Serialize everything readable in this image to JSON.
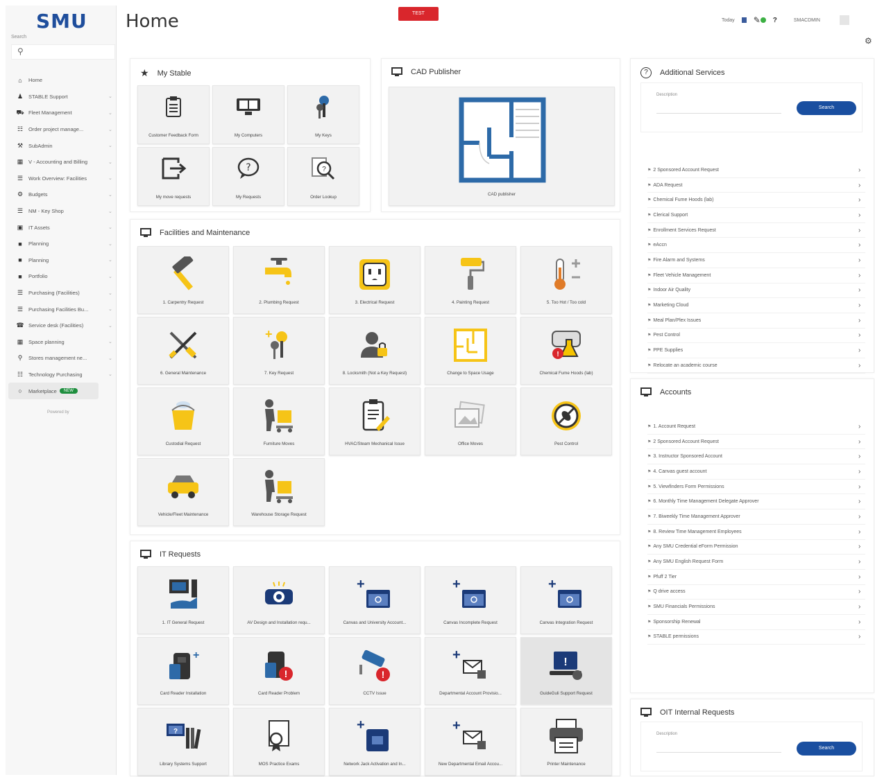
{
  "app": {
    "logo": "SMU",
    "page_title": "Home",
    "test_badge": "TEST"
  },
  "header": {
    "today_label": "Today",
    "help": "?",
    "user": "SMACDMIN"
  },
  "sidebar": {
    "search_label": "Search",
    "items": [
      {
        "label": "Home",
        "icon": "home-icon"
      },
      {
        "label": "STABLE Support",
        "icon": "person-icon"
      },
      {
        "label": "Fleet Management",
        "icon": "car-icon"
      },
      {
        "label": "Order project manage...",
        "icon": "cart-icon"
      },
      {
        "label": "SubAdmin",
        "icon": "wrench-icon"
      },
      {
        "label": "V - Accounting and Billing",
        "icon": "ledger-icon"
      },
      {
        "label": "Work Overview: Facilities",
        "icon": "list-icon"
      },
      {
        "label": "Budgets",
        "icon": "gear-icon"
      },
      {
        "label": "NM - Key Shop",
        "icon": "list-icon"
      },
      {
        "label": "IT Assets",
        "icon": "monitor-icon"
      },
      {
        "label": "Planning",
        "icon": "doc-icon"
      },
      {
        "label": "Planning",
        "icon": "doc-icon"
      },
      {
        "label": "Portfolio",
        "icon": "doc-icon"
      },
      {
        "label": "Purchasing (Facilities)",
        "icon": "list-icon"
      },
      {
        "label": "Purchasing Facilities Bu...",
        "icon": "list-icon"
      },
      {
        "label": "Service desk (Facilities)",
        "icon": "headset-icon"
      },
      {
        "label": "Space planning",
        "icon": "grid-icon"
      },
      {
        "label": "Stores management ne...",
        "icon": "store-icon"
      },
      {
        "label": "Technology Purchasing",
        "icon": "cart-icon"
      }
    ],
    "marketplace_label": "Marketplace",
    "marketplace_badge": "NEW",
    "footer": "Powered by"
  },
  "my_stable": {
    "title": "My Stable",
    "tiles": [
      "Customer Feedback Form",
      "My Computers",
      "My Keys",
      "My move requests",
      "My Requests",
      "Order Lookup"
    ]
  },
  "cad": {
    "title": "CAD Publisher",
    "tile": "CAD publisher"
  },
  "facilities": {
    "title": "Facilities and Maintenance",
    "tiles": [
      "1. Carpentry Request",
      "2. Plumbing Request",
      "3. Electrical Request",
      "4. Painting Request",
      "5. Too Hot / Too cold",
      "6. General Maintenance",
      "7. Key Request",
      "8. Locksmith (Not a Key Request)",
      "Change to Space Usage",
      "Chemical Fume Hoods (lab)",
      "Custodial Request",
      "Furniture Moves",
      "HVAC/Steam Mechanical Issue",
      "Office Moves",
      "Pest Control",
      "Vehicle/Fleet Maintenance",
      "Warehouse Storage Request"
    ]
  },
  "it": {
    "title": "IT Requests",
    "tiles": [
      "1. IT General Request",
      "AV Design and Installation requ...",
      "Canvas and University Account...",
      "Canvas Incomplete Request",
      "Canvas Integration Request",
      "Card Reader Installation",
      "Card Reader Problem",
      "CCTV Issue",
      "Departmental Account Provisio...",
      "GuideGuli Support Request",
      "Library Systems Support",
      "MOS Practice Exams",
      "Network Jack Activation and In...",
      "New Departmental Email Accou...",
      "Printer Maintenance"
    ]
  },
  "additional": {
    "title": "Additional Services",
    "description_label": "Description",
    "search_button": "Search",
    "links": [
      "2 Sponsored Account Request",
      "ADA Request",
      "Chemical Fume Hoods (lab)",
      "Clerical Support",
      "Enrollment Services Request",
      "eAccn",
      "Fire Alarm and Systems",
      "Fleet Vehicle Management",
      "Indoor Air Quality",
      "Marketing Cloud",
      "Meal Plan/Plex Issues",
      "Pest Control",
      "PPE Supplies",
      "Relocate an academic course"
    ]
  },
  "accounts": {
    "title": "Accounts",
    "links": [
      "1. Account Request",
      "2 Sponsored Account Request",
      "3. Instructor Sponsored Account",
      "4. Canvas guest account",
      "5. Viewfinders Form Permissions",
      "6. Monthly Time Management Delegate Approver",
      "7. Biweekly Time Management Approver",
      "8. Review Time Management Employees",
      "Any SMU Credential eForm Permission",
      "Any SMU English Request Form",
      "Pfuff 2 Tier",
      "Q drive access",
      "SMU Financials Permissions",
      "Sponsorship Renewal",
      "STABLE permissions"
    ]
  },
  "oit": {
    "title": "OIT Internal Requests",
    "description_label": "Description",
    "search_button": "Search"
  },
  "colors": {
    "brand": "#1f4e9c",
    "accent_yellow": "#f6c417",
    "navy_icon": "#1b3a78",
    "badge_green": "#1e8e3e",
    "test_red": "#d9262c"
  }
}
